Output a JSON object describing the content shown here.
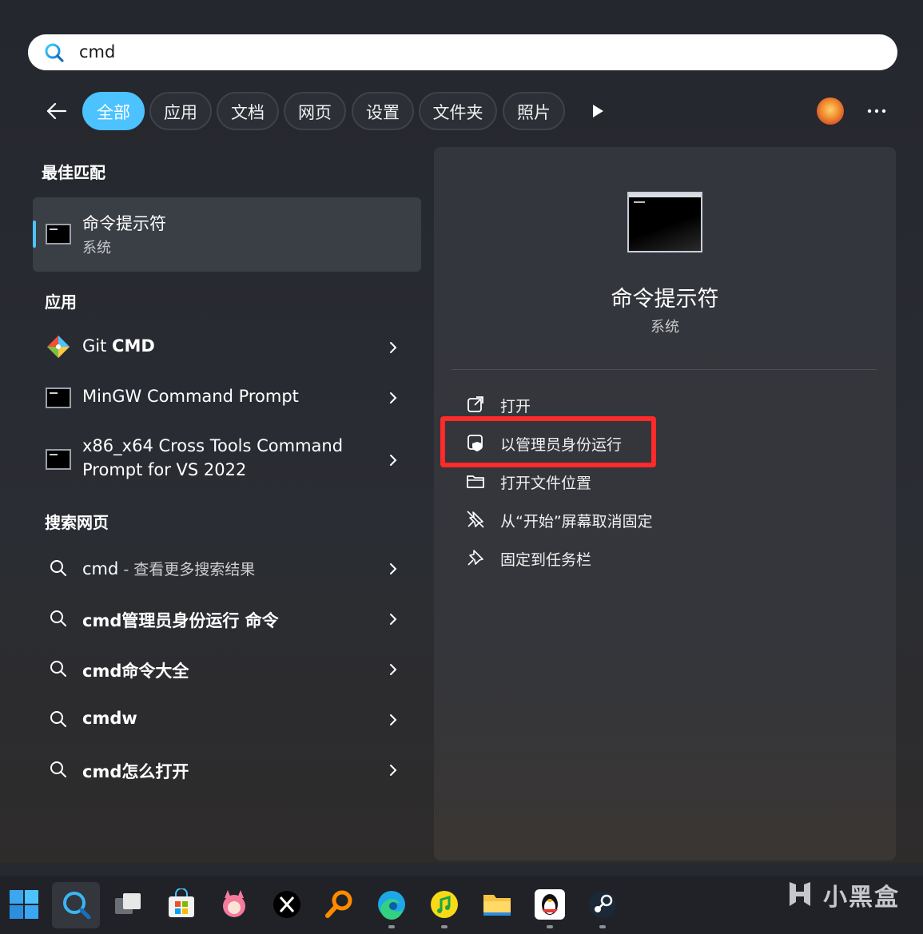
{
  "search": {
    "query": "cmd"
  },
  "filters": [
    "全部",
    "应用",
    "文档",
    "网页",
    "设置",
    "文件夹",
    "照片"
  ],
  "left": {
    "best_match_heading": "最佳匹配",
    "best_match": {
      "title": "命令提示符",
      "subtitle": "系统"
    },
    "apps_heading": "应用",
    "apps": [
      {
        "title_prefix": "Git ",
        "title_bold": "CMD"
      },
      {
        "title": "MinGW Command Prompt"
      },
      {
        "title_line1": "x86_x64 Cross Tools Command",
        "title_line2": "Prompt for VS 2022"
      }
    ],
    "web_heading": "搜索网页",
    "web": [
      {
        "bold": "cmd",
        "muted": " - 查看更多搜索结果"
      },
      {
        "bold": "cmd管理员身份运行 命令"
      },
      {
        "bold": "cmd命令大全"
      },
      {
        "bold": "cmdw"
      },
      {
        "bold": "cmd怎么打开"
      }
    ]
  },
  "detail": {
    "title": "命令提示符",
    "subtitle": "系统",
    "actions": [
      "打开",
      "以管理员身份运行",
      "打开文件位置",
      "从“开始”屏幕取消固定",
      "固定到任务栏"
    ]
  },
  "watermark": "小黑盒",
  "colors": {
    "accent": "#4cc2ff",
    "highlight": "#ff2a2a"
  },
  "taskbar_icons": [
    "windows-start-icon",
    "search-icon",
    "task-view-icon",
    "store-icon",
    "anime-app-icon",
    "x-icon",
    "magnifier-app-icon",
    "edge-icon",
    "music-app-icon",
    "file-explorer-icon",
    "qq-icon",
    "steam-icon"
  ]
}
